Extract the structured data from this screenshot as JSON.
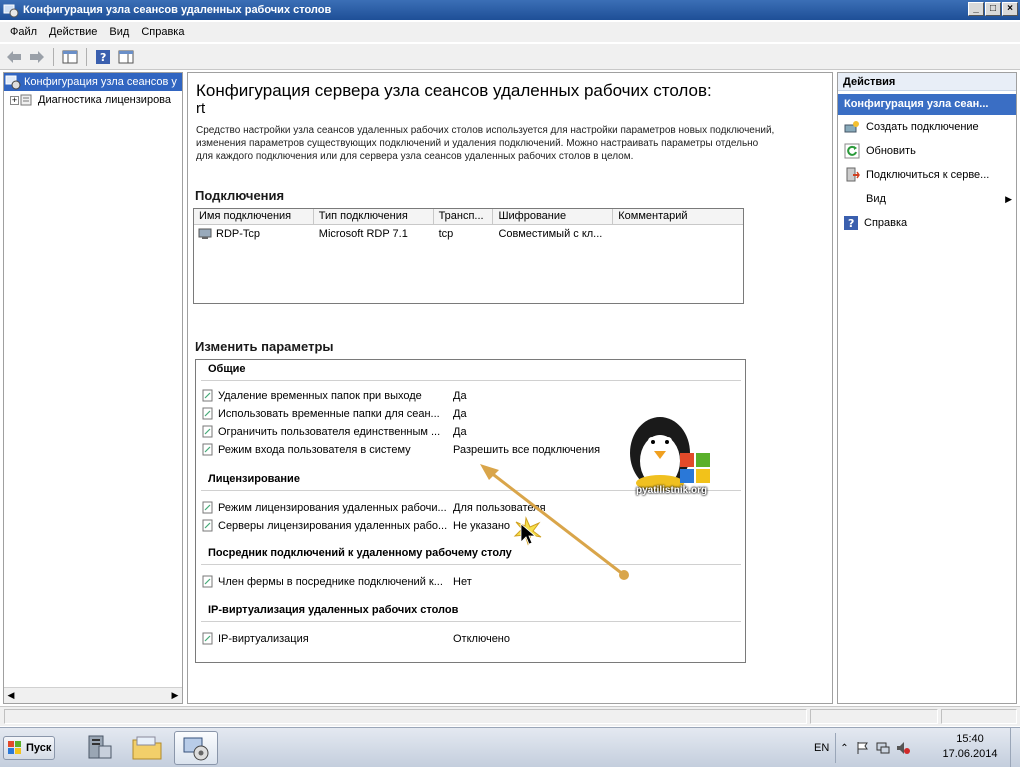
{
  "window": {
    "title": "Конфигурация узла сеансов удаленных рабочих столов",
    "btn_min": "_",
    "btn_max": "□",
    "btn_close": "×"
  },
  "menu": {
    "file": "Файл",
    "action": "Действие",
    "view": "Вид",
    "help": "Справка"
  },
  "tree": {
    "root": "Конфигурация узла сеансов у",
    "child": "Диагностика лицензирова"
  },
  "center": {
    "title": "Конфигурация сервера узла сеансов удаленных рабочих столов:",
    "server": "rt",
    "description": "Средство настройки узла сеансов удаленных рабочих столов используется для настройки параметров новых подключений, изменения параметров существующих подключений и удаления подключений. Можно настраивать параметры отдельно для каждого подключения или для сервера узла сеансов удаленных рабочих столов в целом.",
    "connections_title": "Подключения",
    "columns": [
      "Имя подключения",
      "Тип подключения",
      "Трансп...",
      "Шифрование",
      "Комментарий"
    ],
    "rows": [
      [
        "RDP-Tcp",
        "Microsoft RDP 7.1",
        "tcp",
        "Совместимый с кл...",
        ""
      ]
    ],
    "params_title": "Изменить параметры",
    "groups": [
      {
        "title": "Общие",
        "items": [
          {
            "name": "Удаление временных папок при выходе",
            "value": "Да"
          },
          {
            "name": "Использовать временные папки для сеан...",
            "value": "Да"
          },
          {
            "name": "Ограничить пользователя единственным ...",
            "value": "Да"
          },
          {
            "name": "Режим входа пользователя в систему",
            "value": "Разрешить все подключения"
          }
        ]
      },
      {
        "title": "Лицензирование",
        "items": [
          {
            "name": "Режим лицензирования удаленных рабочи...",
            "value": "Для пользователя"
          },
          {
            "name": "Серверы лицензирования удаленных рабо...",
            "value": "Не указано"
          }
        ]
      },
      {
        "title": "Посредник подключений к удаленному рабочему столу",
        "items": [
          {
            "name": "Член фермы в посреднике подключений к...",
            "value": "Нет"
          }
        ]
      },
      {
        "title": "IP-виртуализация удаленных рабочих столов",
        "items": [
          {
            "name": "IP-виртуализация",
            "value": "Отключено"
          }
        ]
      }
    ]
  },
  "actions": {
    "header": "Действия",
    "subheader": "Конфигурация узла сеан...",
    "items": [
      {
        "label": "Создать подключение",
        "icon": "new-connection-icon"
      },
      {
        "label": "Обновить",
        "icon": "refresh-icon"
      },
      {
        "label": "Подключиться к серве...",
        "icon": "connect-server-icon"
      },
      {
        "label": "Вид",
        "icon": ""
      },
      {
        "label": "Справка",
        "icon": "help-icon"
      }
    ]
  },
  "watermark": {
    "text": "pyatilistnik.org"
  },
  "taskbar": {
    "start": "Пуск",
    "lang": "EN",
    "time": "15:40",
    "date": "17.06.2014"
  },
  "colors": {
    "title_bar": "#1e4f97",
    "selection": "#3165c1",
    "annotation_arrow": "#d9a54a"
  }
}
